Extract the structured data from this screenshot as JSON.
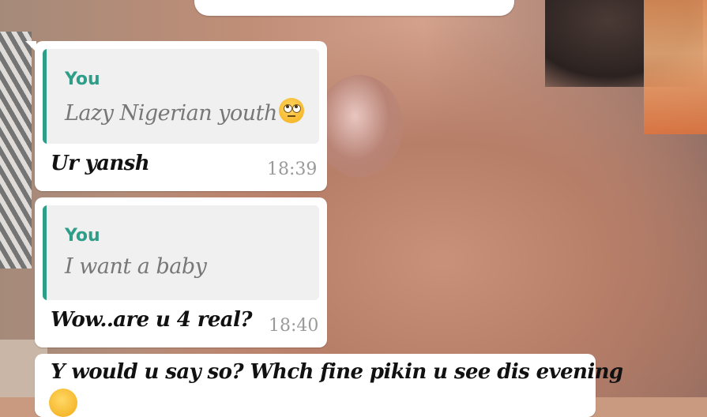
{
  "messages": [
    {
      "quote": {
        "author": "You",
        "text": "Lazy Nigerian youth"
      },
      "text": "Ur yansh",
      "time": "18:39"
    },
    {
      "quote": {
        "author": "You",
        "text": "I want a baby"
      },
      "text": "Wow..are u 4 real?",
      "time": "18:40"
    },
    {
      "text": "Y would u say so? Whch fine pikin u see dis evening"
    }
  ],
  "icons": {
    "quote1_emoji": "face-with-rolling-eyes-icon",
    "partial_emoji": "emoji-icon"
  },
  "colors": {
    "quote_accent": "#2e9e88",
    "bubble": "#ffffff",
    "time": "#9a9a9a"
  }
}
